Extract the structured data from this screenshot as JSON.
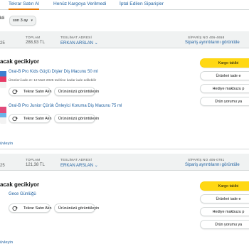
{
  "tabs": [
    "Tekrar Satın Al",
    "Henüz Kargoya Verilmedi",
    "İptal Edilen Siparişler"
  ],
  "filter": {
    "prefix": "ldi",
    "selected": "son 3 ay"
  },
  "orders": [
    {
      "head": {
        "total_label": "TOPLAM",
        "total_value": "288,93 TL",
        "delivery_label": "TESLİMAT ADRESİ",
        "recipient": "ERKAN ARSLAN",
        "order_no_label": "SİPARİŞ NO 406-4658",
        "details_link": "Sipariş ayrıntılarını görüntüle",
        "left_partial": "25"
      },
      "status": "acak gecikiyor",
      "items": [
        {
          "title": "Oral-B Pro Kids Güçlü Dişler Diş Macunu 50 ml",
          "note": "Ürünleri iade et: 12 Mart 2025 tarihine kadar iade edilebilir"
        },
        {
          "title": "Oral-B Pro Junior Çürük Önleyici Koruma Diş Macunu 75 ml",
          "note": ""
        }
      ],
      "actions": [
        "Kargo takibi",
        "Ürünleri iade e",
        "Hediye makbuzu p",
        "Ürün yorumu ya"
      ],
      "footer_link": "üvleyin"
    },
    {
      "head": {
        "total_label": "TOPLAM",
        "total_value": "121,38 TL",
        "delivery_label": "TESLİMAT ADRESİ",
        "recipient": "ERKAN ARSLAN",
        "order_no_label": "SİPARİŞ NO 406-0781",
        "details_link": "Sipariş ayrıntılarını görüntüle",
        "left_partial": "25"
      },
      "status": "acak gecikiyor",
      "items": [
        {
          "title": "Gece Günlüğü",
          "note": ""
        }
      ],
      "actions": [
        "Kargo takibi",
        "Ürünleri iade e",
        "Hediye makbuzu p",
        "Ürün yorumu ya"
      ],
      "footer_link": "üvleyin"
    }
  ],
  "buttons": {
    "buy_again": "Tekrar Satın Alın",
    "view_item": "Ürününüzü görüntüleyin"
  },
  "colors": {
    "link": "#2162a1",
    "primary": "#ffd814",
    "header_bg": "#f0f2f2",
    "tab_accent": "#e77600"
  }
}
